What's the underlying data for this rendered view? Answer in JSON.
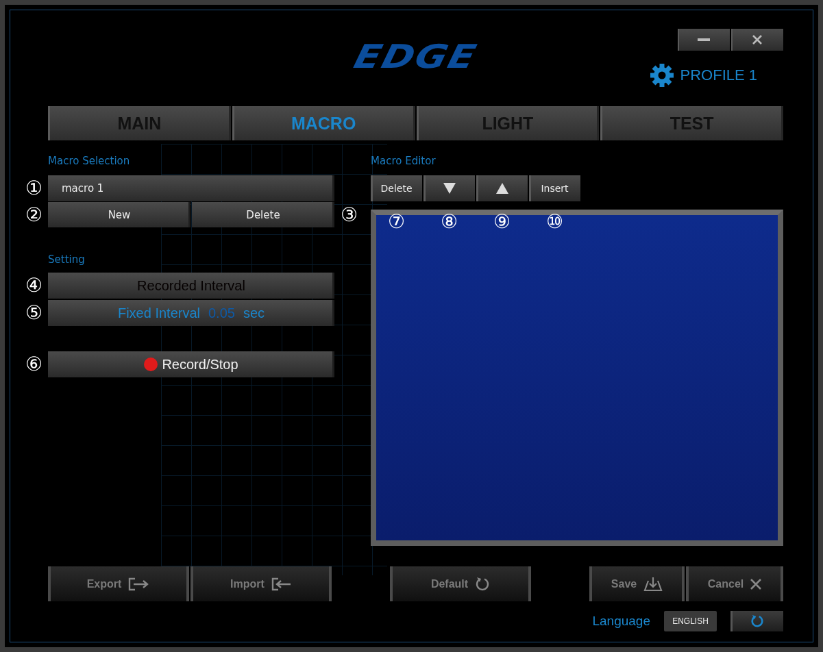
{
  "logo": "EDGE",
  "profile": {
    "label": "PROFILE 1"
  },
  "tabs": [
    {
      "label": "MAIN",
      "selected": false
    },
    {
      "label": "MACRO",
      "selected": true
    },
    {
      "label": "LIGHT",
      "selected": false
    },
    {
      "label": "TEST",
      "selected": false
    }
  ],
  "macro_selection": {
    "title": "Macro Selection",
    "macro": {
      "value": "macro 1",
      "marker": "①"
    },
    "buttons": [
      {
        "label": "New",
        "marker": "②"
      },
      {
        "label": "Delete",
        "marker": "③"
      }
    ]
  },
  "setting": {
    "title": "Setting",
    "options": [
      {
        "label": "Recorded Interval",
        "selected": false,
        "marker": "④"
      },
      {
        "label": "Fixed Interval",
        "value": "0.05",
        "unit": "sec",
        "selected": true,
        "marker": "⑤"
      }
    ],
    "record": {
      "label": "Record/Stop",
      "marker": "⑥"
    }
  },
  "macro_editor": {
    "title": "Macro Editor",
    "buttons": [
      {
        "kind": "text",
        "label": "Delete",
        "marker": "⑦"
      },
      {
        "kind": "down",
        "marker": "⑧"
      },
      {
        "kind": "up",
        "marker": "⑨"
      },
      {
        "kind": "text",
        "label": "Insert",
        "marker": "⑩"
      }
    ]
  },
  "footer": {
    "groups": [
      [
        {
          "label": "Export",
          "kind": "export"
        },
        {
          "label": "Import",
          "kind": "import"
        }
      ],
      [
        {
          "label": "Default",
          "kind": "default"
        }
      ],
      [
        {
          "label": "Save",
          "kind": "save"
        },
        {
          "label": "Cancel",
          "kind": "cancel"
        }
      ]
    ],
    "language": {
      "label": "Language",
      "value": "ENGLISH"
    }
  }
}
